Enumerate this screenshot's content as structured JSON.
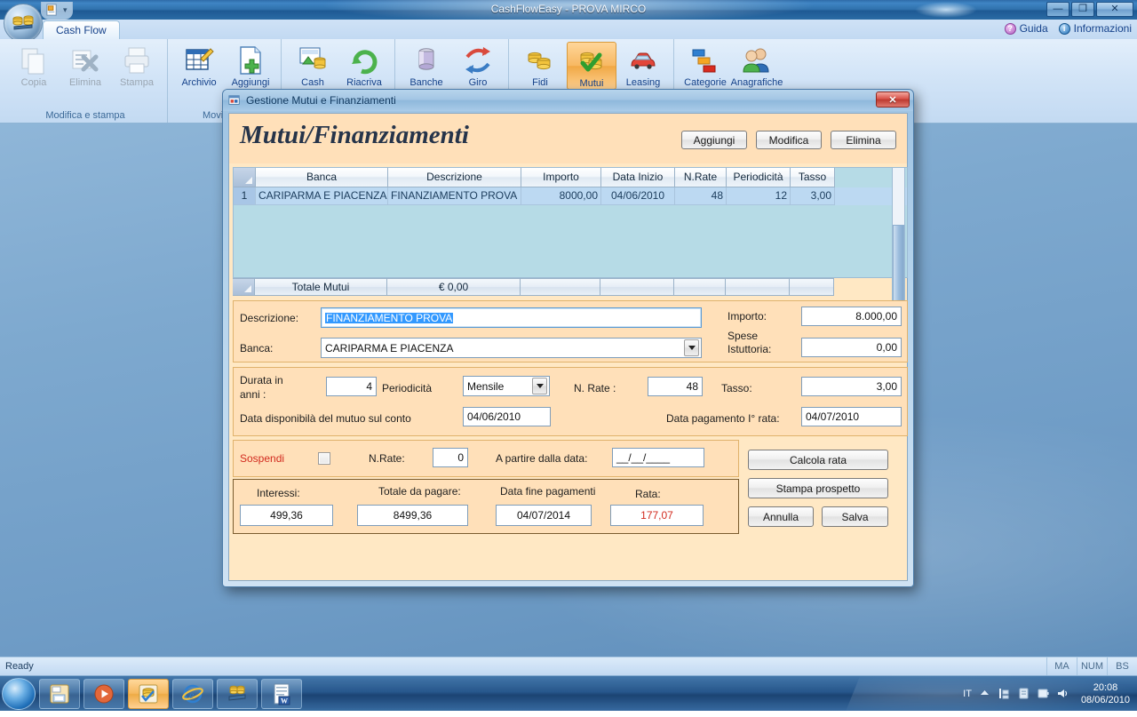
{
  "app": {
    "title": "CashFlowEasy - PROVA MIRCO",
    "window_buttons": {
      "minimize": "—",
      "maximize": "❐",
      "close": "✕"
    },
    "quick_access": {
      "doc_icon": "document-icon",
      "caret": "▾"
    },
    "tabs": [
      {
        "label": "Cash Flow"
      }
    ],
    "help_links": [
      {
        "label": "Guida",
        "icon": "help-icon",
        "badge": "?"
      },
      {
        "label": "Informazioni",
        "icon": "info-icon",
        "badge": "i"
      }
    ],
    "ribbon_groups": [
      {
        "title": "Modifica e stampa",
        "items": [
          {
            "label": "Copia",
            "icon": "copy-icon",
            "disabled": true,
            "selected": false
          },
          {
            "label": "Elimina",
            "icon": "delete-icon",
            "disabled": true,
            "selected": false
          },
          {
            "label": "Stampa",
            "icon": "print-icon",
            "disabled": true,
            "selected": false
          }
        ]
      },
      {
        "title": "Movimenti",
        "items": [
          {
            "label": "Archivio",
            "icon": "archive-grid-icon",
            "disabled": false,
            "selected": false
          },
          {
            "label": "Aggiungi",
            "icon": "add-document-icon",
            "disabled": false,
            "selected": false
          }
        ]
      },
      {
        "title": "",
        "items": [
          {
            "label": "Cash",
            "icon": "cash-icon",
            "disabled": false,
            "selected": false
          },
          {
            "label": "Riacriva",
            "icon": "refresh-icon",
            "disabled": false,
            "selected": false
          }
        ]
      },
      {
        "title": "",
        "items": [
          {
            "label": "Banche",
            "icon": "bank-icon",
            "disabled": false,
            "selected": false
          },
          {
            "label": "Giro",
            "icon": "transfer-icon",
            "disabled": false,
            "selected": false
          }
        ]
      },
      {
        "title": "",
        "items": [
          {
            "label": "Fidi",
            "icon": "coins-icon",
            "disabled": false,
            "selected": false
          },
          {
            "label": "Mutui",
            "icon": "mortgage-check-icon",
            "disabled": false,
            "selected": true
          },
          {
            "label": "Leasing",
            "icon": "car-icon",
            "disabled": false,
            "selected": false
          }
        ]
      },
      {
        "title": "",
        "items": [
          {
            "label": "Categorie",
            "icon": "categories-icon",
            "disabled": false,
            "selected": false
          },
          {
            "label": "Anagrafiche",
            "icon": "people-icon",
            "disabled": false,
            "selected": false
          }
        ]
      }
    ],
    "statusbar": {
      "ready": "Ready",
      "indicators": [
        "MA",
        "NUM",
        "BS"
      ]
    }
  },
  "taskbar": {
    "start_icon": "windows-start-icon",
    "buttons": [
      {
        "icon": "explorer-icon",
        "active": false
      },
      {
        "icon": "media-player-icon",
        "active": false
      },
      {
        "icon": "cashflow-app-icon",
        "active": true
      },
      {
        "icon": "internet-explorer-icon",
        "active": false
      },
      {
        "icon": "coins-app-icon",
        "active": false
      },
      {
        "icon": "word-icon",
        "active": false
      }
    ],
    "tray": {
      "language": "IT",
      "icons": [
        "show-hidden-icon",
        "network-icon",
        "action-center-icon",
        "battery-icon",
        "volume-icon"
      ]
    },
    "clock": {
      "time": "20:08",
      "date": "08/06/2010"
    }
  },
  "dialog": {
    "title": "Gestione Mutui e Finanziamenti",
    "title_icon": "window-form-icon",
    "close_label": "✕",
    "heading": "Mutui/Finanziamenti",
    "head_buttons": [
      {
        "label": "Aggiungi"
      },
      {
        "label": "Modifica"
      },
      {
        "label": "Elimina"
      }
    ],
    "grid": {
      "columns": [
        "",
        "Banca",
        "Descrizione",
        "Importo",
        "Data Inizio",
        "N.Rate",
        "Periodicità",
        "Tasso"
      ],
      "rows": [
        {
          "index": "1",
          "banca": "CARIPARMA E PIACENZA",
          "descrizione": "FINANZIAMENTO PROVA",
          "importo": "8000,00",
          "data_inizio": "04/06/2010",
          "n_rate": "48",
          "periodicita": "12",
          "tasso": "3,00"
        }
      ],
      "footer": [
        "",
        "Totale Mutui",
        "€ 0,00",
        "",
        "",
        "",
        "",
        ""
      ]
    },
    "form": {
      "descrizione_label": "Descrizione:",
      "descrizione_value": "FINANZIAMENTO PROVA",
      "banca_label": "Banca:",
      "banca_value": "CARIPARMA E PIACENZA",
      "importo_label": "Importo:",
      "importo_value": "8.000,00",
      "spese_label_1": "Spese",
      "spese_label_2": "Istuttoria:",
      "spese_value": "0,00",
      "durata_label_1": "Durata in",
      "durata_label_2": "anni :",
      "durata_value": "4",
      "periodicita_label": "Periodicità",
      "periodicita_value": "Mensile",
      "nrate_label": "N. Rate :",
      "nrate_value": "48",
      "tasso_label": "Tasso:",
      "tasso_value": "3,00",
      "data_disponibilita_label": "Data disponibilà del mutuo sul conto",
      "data_disponibilita_value": "04/06/2010",
      "data_pagamento_label": "Data pagamento I° rata:",
      "data_pagamento_value": "04/07/2010"
    },
    "suspend": {
      "label": "Sospendi",
      "checked": false,
      "nrate_label": "N.Rate:",
      "nrate_value": "0",
      "dalla_data_label": "A partire dalla data:",
      "dalla_data_value": "__/__/____"
    },
    "summary": {
      "interessi_label": "Interessi:",
      "interessi_value": "499,36",
      "totale_label": "Totale da pagare:",
      "totale_value": "8499,36",
      "data_fine_label": "Data fine pagamenti",
      "data_fine_value": "04/07/2014",
      "rata_label": "Rata:",
      "rata_value": "177,07"
    },
    "action_buttons": [
      {
        "label": "Calcola rata"
      },
      {
        "label": "Stampa prospetto"
      },
      {
        "label": "Annulla"
      },
      {
        "label": "Salva"
      }
    ]
  },
  "colors": {
    "dialog_cream": "#ffe0b9",
    "grid_body": "#b6dbe6",
    "row_selected": "#bcd9f2",
    "accent_red": "#d22b1f",
    "selection_blue": "#3399ff"
  }
}
